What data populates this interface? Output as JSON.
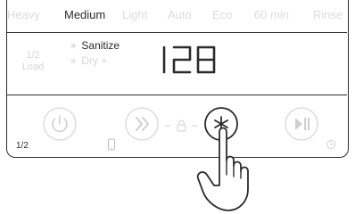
{
  "cycles": [
    {
      "label": "Heavy",
      "active": false
    },
    {
      "label": "Medium",
      "active": true
    },
    {
      "label": "Light",
      "active": false
    },
    {
      "label": "Auto",
      "active": false
    },
    {
      "label": "Eco",
      "active": false
    },
    {
      "label": "60 min",
      "active": false
    },
    {
      "label": "Rinse",
      "active": false
    }
  ],
  "load": {
    "line1": "1/2",
    "line2": "Load"
  },
  "options": {
    "sanitize": {
      "label": "Sanitize",
      "active": true
    },
    "dry_plus": {
      "label": "Dry +",
      "active": false
    }
  },
  "display": {
    "value": "128"
  },
  "bottom": {
    "half_load_label": "1/2"
  },
  "icons": {
    "power": "power-icon",
    "cycle_select": "double-chevron-icon",
    "lock": "lock-icon",
    "option": "asterisk-icon",
    "start": "play-pause-icon",
    "hand": "pointing-hand-icon",
    "phone": "phone-icon",
    "delay": "clock-icon"
  },
  "colors": {
    "active": "#2b2b2b",
    "inactive": "#d8d8d8"
  }
}
